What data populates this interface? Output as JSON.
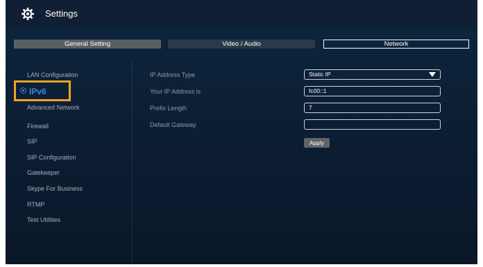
{
  "header": {
    "title": "Settings",
    "icon": "gear-icon"
  },
  "tabs": [
    {
      "label": "General Setting",
      "active": false
    },
    {
      "label": "Video / Audio",
      "active": false
    },
    {
      "label": "Network",
      "active": true
    }
  ],
  "sidebar": {
    "items": [
      {
        "label": "LAN Configuration"
      },
      {
        "label": "IPv6",
        "selected": true
      },
      {
        "label": "Advanced Network"
      },
      {
        "label": "Firewall"
      },
      {
        "label": "SIP"
      },
      {
        "label": "SIP Configuration"
      },
      {
        "label": "Gatekeeper"
      },
      {
        "label": "Skype For Business"
      },
      {
        "label": "RTMP"
      },
      {
        "label": "Test Utilities"
      }
    ]
  },
  "form": {
    "ip_address_type": {
      "label": "IP Address Type",
      "value": "Static IP"
    },
    "ip_address": {
      "label": "Your IP Address is",
      "value": "fc00::1"
    },
    "prefix_length": {
      "label": "Prefix Length",
      "value": "7"
    },
    "default_gateway": {
      "label": "Default Gateway",
      "value": ""
    },
    "apply_label": "Apply"
  },
  "colors": {
    "accent_highlight": "#f0a423",
    "selected_text": "#2e8fd8",
    "background": "#0d2036"
  }
}
